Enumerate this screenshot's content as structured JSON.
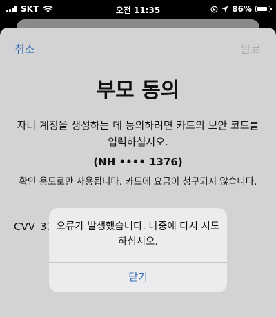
{
  "status_bar": {
    "carrier": "SKT",
    "time": "오전 11:35",
    "battery": "86%",
    "battery_level": 0.86
  },
  "sheet": {
    "cancel_label": "취소",
    "done_label": "완료",
    "title": "부모 동의",
    "description": "자녀 계정을 생성하는 데 동의하려면 카드의 보안 코드를 입력하십시오.",
    "card_id": "(NH •••• 1376)",
    "notice": "확인 용도로만 사용됩니다. 카드에 요금이 청구되지 않습니다.",
    "cvv_label": "CVV",
    "cvv_value": "37"
  },
  "alert": {
    "message": "오류가 발생했습니다. 나중에 다시 시도하십시오.",
    "close_label": "닫기"
  },
  "colors": {
    "accent": "#2f6fb3",
    "disabled": "#a8a8aa"
  }
}
